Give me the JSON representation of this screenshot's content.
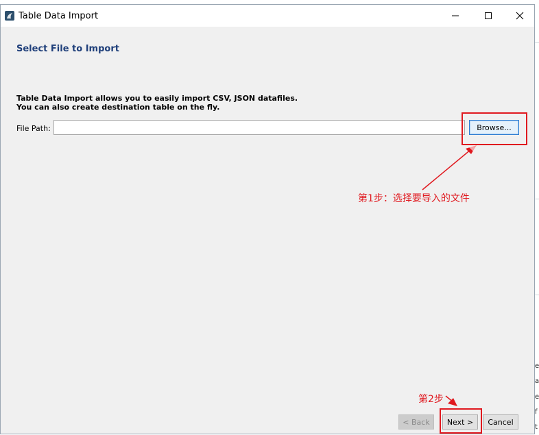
{
  "window": {
    "title": "Table Data Import",
    "controls": {
      "minimize_icon": "minimize-icon",
      "maximize_icon": "maximize-icon",
      "close_icon": "close-icon"
    }
  },
  "page": {
    "heading": "Select File to Import",
    "description_line1": "Table Data Import allows you to easily import CSV, JSON datafiles.",
    "description_line2": "You can also create destination table on the fly."
  },
  "file_path": {
    "label": "File Path:",
    "value": "",
    "browse_label": "Browse..."
  },
  "annotations": {
    "step1": "第1步：选择要导入的文件",
    "step2": "第2步"
  },
  "footer": {
    "back_label": "< Back",
    "next_label": "Next >",
    "cancel_label": "Cancel"
  },
  "background_fragments": [
    "e",
    "al",
    "er",
    "f",
    "t"
  ],
  "colors": {
    "heading": "#1f3f7a",
    "annotation_red": "#e0191f",
    "browse_border": "#2f7dd1"
  }
}
